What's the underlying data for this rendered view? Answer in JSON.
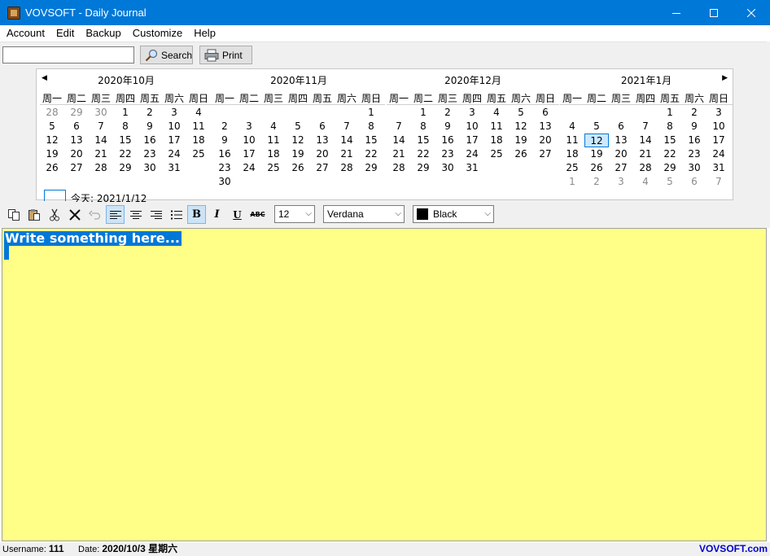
{
  "window": {
    "title": "VOVSOFT - Daily Journal",
    "minimize": "—",
    "maximize": "☐",
    "close": "✕"
  },
  "menu": [
    "Account",
    "Edit",
    "Backup",
    "Customize",
    "Help"
  ],
  "search": {
    "value": "",
    "button_label": "Search",
    "print_label": "Print"
  },
  "calendar": {
    "nav_prev": "◀",
    "nav_next": "▶",
    "weekdays": [
      "周一",
      "周二",
      "周三",
      "周四",
      "周五",
      "周六",
      "周日"
    ],
    "today_label": "今天: 2021/1/12",
    "selected_date": "2021-01-12",
    "months": [
      {
        "title": "2020年10月",
        "days": [
          [
            "28",
            "29",
            "30",
            "1",
            "2",
            "3",
            "4"
          ],
          [
            "5",
            "6",
            "7",
            "8",
            "9",
            "10",
            "11"
          ],
          [
            "12",
            "13",
            "14",
            "15",
            "16",
            "17",
            "18"
          ],
          [
            "19",
            "20",
            "21",
            "22",
            "23",
            "24",
            "25"
          ],
          [
            "26",
            "27",
            "28",
            "29",
            "30",
            "31",
            ""
          ]
        ],
        "muted": [
          [
            0,
            0
          ],
          [
            0,
            1
          ],
          [
            0,
            2
          ]
        ]
      },
      {
        "title": "2020年11月",
        "days": [
          [
            "",
            "",
            "",
            "",
            "",
            "",
            "1"
          ],
          [
            "2",
            "3",
            "4",
            "5",
            "6",
            "7",
            "8"
          ],
          [
            "9",
            "10",
            "11",
            "12",
            "13",
            "14",
            "15"
          ],
          [
            "16",
            "17",
            "18",
            "19",
            "20",
            "21",
            "22"
          ],
          [
            "23",
            "24",
            "25",
            "26",
            "27",
            "28",
            "29"
          ],
          [
            "30",
            "",
            "",
            "",
            "",
            "",
            ""
          ]
        ],
        "muted": []
      },
      {
        "title": "2020年12月",
        "days": [
          [
            "",
            "1",
            "2",
            "3",
            "4",
            "5",
            "6"
          ],
          [
            "7",
            "8",
            "9",
            "10",
            "11",
            "12",
            "13"
          ],
          [
            "14",
            "15",
            "16",
            "17",
            "18",
            "19",
            "20"
          ],
          [
            "21",
            "22",
            "23",
            "24",
            "25",
            "26",
            "27"
          ],
          [
            "28",
            "29",
            "30",
            "31",
            "",
            "",
            ""
          ]
        ],
        "muted": []
      },
      {
        "title": "2021年1月",
        "days": [
          [
            "",
            "",
            "",
            "",
            "1",
            "2",
            "3"
          ],
          [
            "4",
            "5",
            "6",
            "7",
            "8",
            "9",
            "10"
          ],
          [
            "11",
            "12",
            "13",
            "14",
            "15",
            "16",
            "17"
          ],
          [
            "18",
            "19",
            "20",
            "21",
            "22",
            "23",
            "24"
          ],
          [
            "25",
            "26",
            "27",
            "28",
            "29",
            "30",
            "31"
          ],
          [
            "1",
            "2",
            "3",
            "4",
            "5",
            "6",
            "7"
          ]
        ],
        "muted": [
          [
            5,
            0
          ],
          [
            5,
            1
          ],
          [
            5,
            2
          ],
          [
            5,
            3
          ],
          [
            5,
            4
          ],
          [
            5,
            5
          ],
          [
            5,
            6
          ]
        ],
        "today": [
          2,
          1
        ]
      }
    ]
  },
  "format_toolbar": {
    "font_size": "12",
    "font_name": "Verdana",
    "font_color": "Black",
    "color_hex": "#000000",
    "icons": [
      "copy-icon",
      "paste-icon",
      "cut-icon",
      "delete-icon",
      "undo-icon",
      "align-left-icon",
      "align-center-icon",
      "align-right-icon",
      "bullet-list-icon",
      "bold-icon",
      "italic-icon",
      "underline-icon",
      "strikethrough-icon"
    ]
  },
  "editor": {
    "text": "Write something here...",
    "background": "#ffff88"
  },
  "status": {
    "username_label": "Username:",
    "username": "111",
    "date_label": "Date:",
    "date": "2020/10/3 星期六",
    "link": "VOVSOFT.com"
  }
}
